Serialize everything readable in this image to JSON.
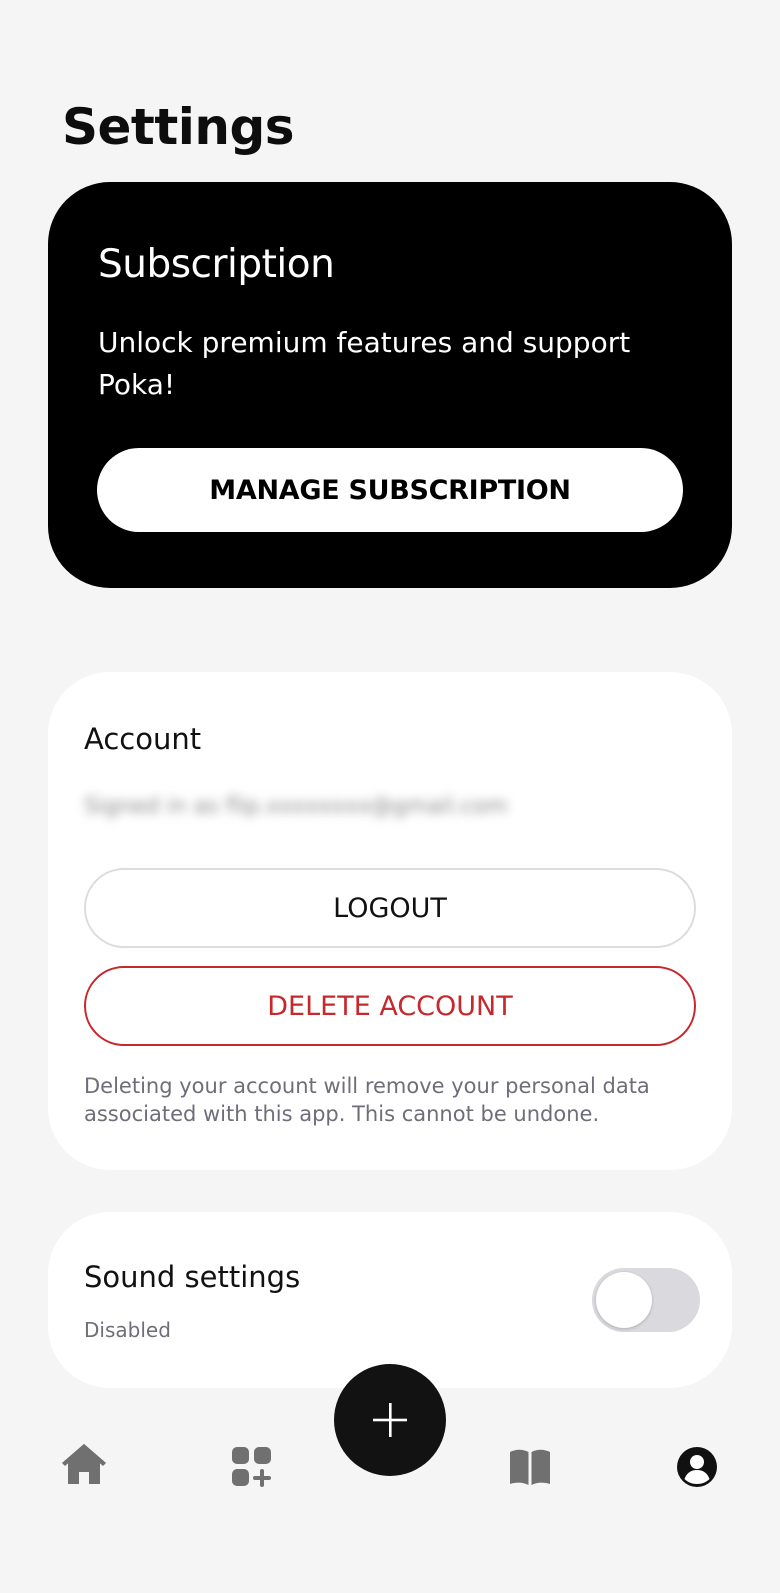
{
  "page": {
    "title": "Settings"
  },
  "subscription": {
    "title": "Subscription",
    "description": "Unlock premium features and support Poka!",
    "button_label": "MANAGE SUBSCRIPTION"
  },
  "account": {
    "title": "Account",
    "signed_in_text": "Signed in as flip.xxxxxxxx@gmail.com",
    "logout_label": "LOGOUT",
    "delete_label": "DELETE ACCOUNT",
    "delete_note": "Deleting your account will remove your personal data associated with this app. This cannot be undone."
  },
  "sound": {
    "title": "Sound settings",
    "status": "Disabled",
    "enabled": false
  },
  "nav": {
    "items": [
      {
        "icon": "home-icon"
      },
      {
        "icon": "add-category-icon"
      },
      {
        "icon": "plus-icon"
      },
      {
        "icon": "book-icon"
      },
      {
        "icon": "profile-icon"
      }
    ]
  },
  "colors": {
    "background": "#f5f5f5",
    "danger": "#c6282c",
    "toggle_off": "#d9d9de",
    "nav_inactive": "#707070",
    "nav_active": "#111111"
  }
}
